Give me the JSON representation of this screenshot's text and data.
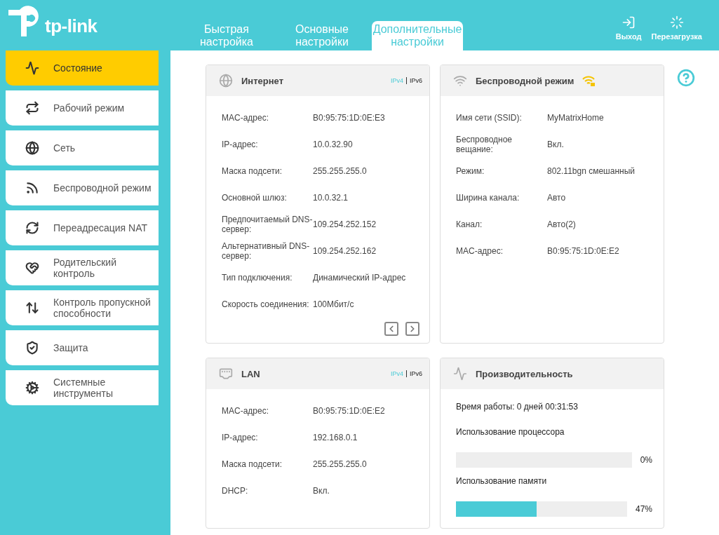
{
  "header": {
    "logo": "tp-link",
    "tabs": [
      {
        "label": "Быстрая настройка",
        "selected": false
      },
      {
        "label": "Основные настройки",
        "selected": false
      },
      {
        "label": "Дополнительные настройки",
        "selected": true
      }
    ],
    "actions": [
      {
        "label": "Выход"
      },
      {
        "label": "Перезагрузка"
      }
    ]
  },
  "sidebar": {
    "items": [
      {
        "label": "Состояние",
        "selected": true
      },
      {
        "label": "Рабочий режим",
        "selected": false
      },
      {
        "label": "Сеть",
        "selected": false
      },
      {
        "label": "Беспроводной режим",
        "selected": false
      },
      {
        "label": "Переадресация NAT",
        "selected": false
      },
      {
        "label": "Родительский контроль",
        "selected": false
      },
      {
        "label": "Контроль пропускной способности",
        "selected": false
      },
      {
        "label": "Защита",
        "selected": false
      },
      {
        "label": "Системные инструменты",
        "selected": false
      }
    ]
  },
  "cards": [
    {
      "kind": "info",
      "title": "Интернет",
      "ip_versions": [
        {
          "label": "IPv4",
          "selected": true
        },
        {
          "label": "IPv6",
          "selected": false
        }
      ],
      "pager": true,
      "rows": [
        {
          "label": "MAC-адрес:",
          "value": "B0:95:75:1D:0E:E3"
        },
        {
          "label": "IP-адрес:",
          "value": "10.0.32.90"
        },
        {
          "label": "Маска подсети:",
          "value": "255.255.255.0"
        },
        {
          "label": "Основной шлюз:",
          "value": "10.0.32.1"
        },
        {
          "label": "Предпочитаемый DNS-сервер:",
          "value": "109.254.252.152"
        },
        {
          "label": "Альтернативный DNS-сервер:",
          "value": "109.254.252.162"
        },
        {
          "label": "Тип подключения:",
          "value": "Динамический IP-адрес"
        },
        {
          "label": "Скорость соединения:",
          "value": "100Мбит/с"
        }
      ]
    },
    {
      "kind": "info",
      "title": "Беспроводной режим",
      "secured": true,
      "rows": [
        {
          "label": "Имя сети (SSID):",
          "value": "MyMatrixHome"
        },
        {
          "label": "Беспроводное вещание:",
          "value": "Вкл."
        },
        {
          "label": "Режим:",
          "value": "802.11bgn смешанный"
        },
        {
          "label": "Ширина канала:",
          "value": "Авто"
        },
        {
          "label": "Канал:",
          "value": "Авто(2)"
        },
        {
          "label": "MAC-адрес:",
          "value": "B0:95:75:1D:0E:E2"
        }
      ]
    },
    {
      "kind": "info",
      "title": "LAN",
      "ip_versions": [
        {
          "label": "IPv4",
          "selected": true
        },
        {
          "label": "IPv6",
          "selected": false
        }
      ],
      "rows": [
        {
          "label": "MAC-адрес:",
          "value": "B0:95:75:1D:0E:E2"
        },
        {
          "label": "IP-адрес:",
          "value": "192.168.0.1"
        },
        {
          "label": "Маска подсети:",
          "value": "255.255.255.0"
        },
        {
          "label": "DHCP:",
          "value": "Вкл."
        }
      ]
    },
    {
      "kind": "performance",
      "title": "Производительность",
      "uptime": "Время работы: 0 дней 00:31:53",
      "meters": [
        {
          "label": "Использование процессора",
          "level": 0,
          "reading": "0%"
        },
        {
          "label": "Использование памяти",
          "level": 0.47,
          "reading": "47%"
        }
      ]
    }
  ]
}
